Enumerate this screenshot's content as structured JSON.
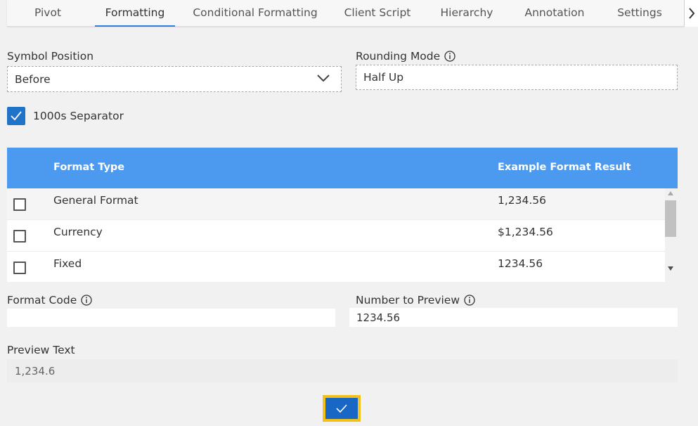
{
  "tabs": [
    {
      "label": "Pivot"
    },
    {
      "label": "Formatting"
    },
    {
      "label": "Conditional Formatting"
    },
    {
      "label": "Client Script"
    },
    {
      "label": "Hierarchy"
    },
    {
      "label": "Annotation"
    },
    {
      "label": "Settings"
    }
  ],
  "active_tab": "Formatting",
  "symbol_position": {
    "label": "Symbol Position",
    "value": "Before"
  },
  "rounding_mode": {
    "label": "Rounding Mode",
    "value": "Half Up"
  },
  "separator": {
    "label": "1000s Separator",
    "checked": true
  },
  "grid": {
    "columns": [
      "Format Type",
      "Example Format Result"
    ],
    "rows": [
      {
        "type": "General Format",
        "example": "1,234.56",
        "checked": false
      },
      {
        "type": "Currency",
        "example": "$1,234.56",
        "checked": false
      },
      {
        "type": "Fixed",
        "example": "1234.56",
        "checked": false
      }
    ]
  },
  "format_code": {
    "label": "Format Code",
    "value": ""
  },
  "number_to_preview": {
    "label": "Number to Preview",
    "value": "1234.56"
  },
  "preview_text": {
    "label": "Preview Text",
    "value": "1,234.6"
  },
  "colors": {
    "accent": "#2f7fd6",
    "grid_header": "#4b9af0",
    "ok_button": "#1967c5",
    "highlight": "#f2c21b"
  }
}
